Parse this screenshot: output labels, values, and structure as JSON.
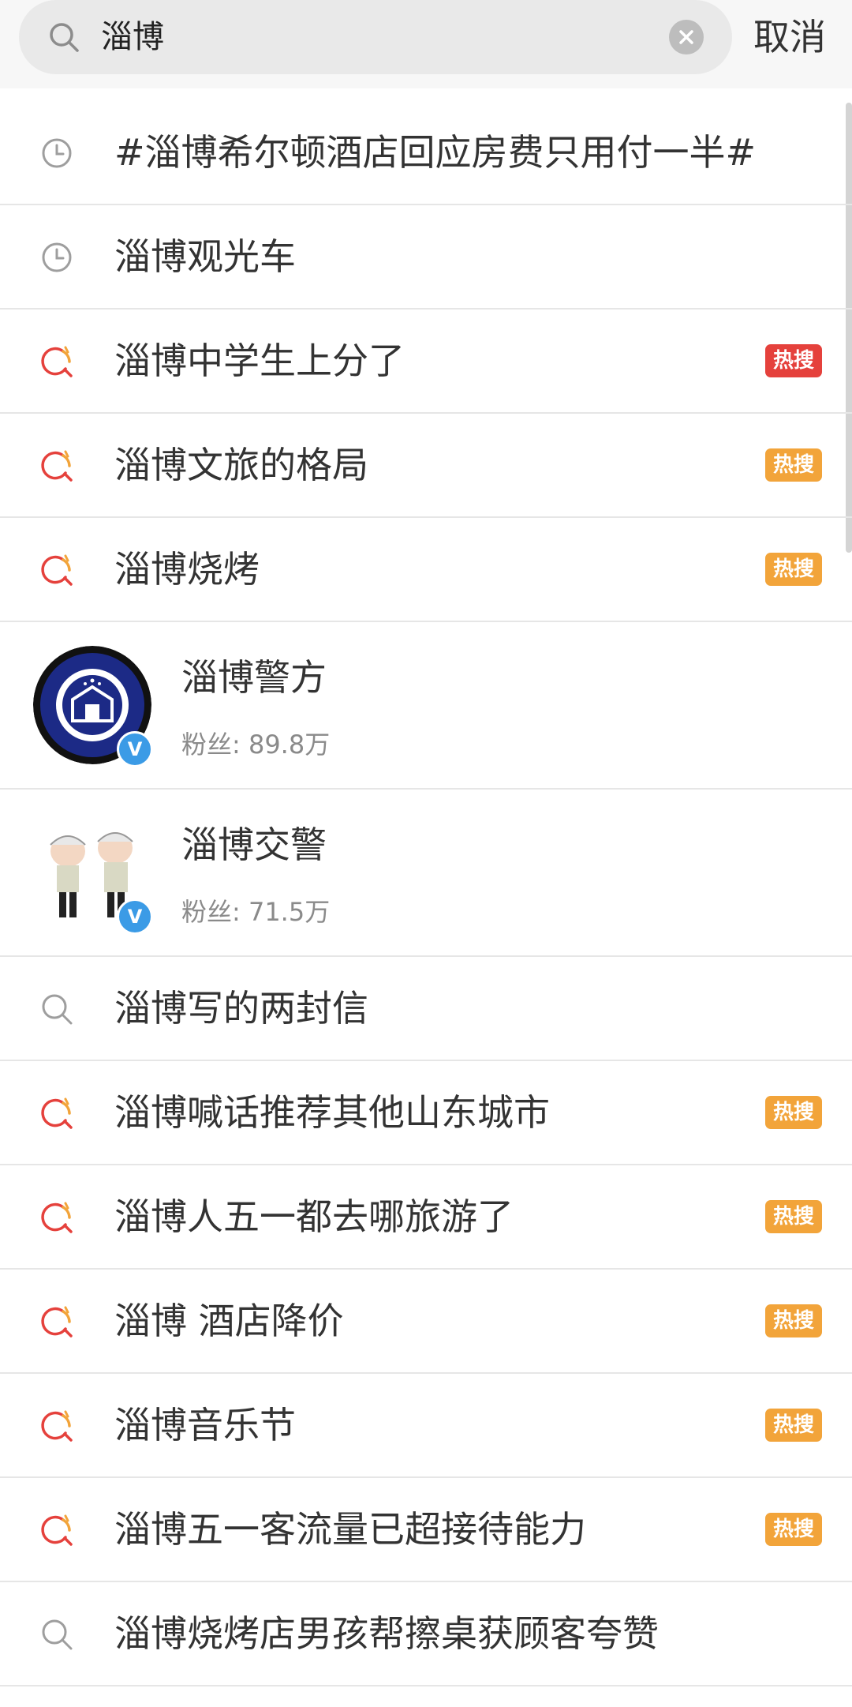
{
  "search": {
    "query": "淄博",
    "cancel_label": "取消"
  },
  "suggestions_top": [
    {
      "icon": "history-icon",
      "label": "#淄博希尔顿酒店回应房费只用付一半#",
      "badge": null
    },
    {
      "icon": "history-icon",
      "label": "淄博观光车",
      "badge": null
    },
    {
      "icon": "hot-search-icon",
      "label": "淄博中学生上分了",
      "badge": "热搜",
      "badge_color": "#e5413c"
    },
    {
      "icon": "hot-search-icon",
      "label": "淄博文旅的格局",
      "badge": "热搜",
      "badge_color": "#f2a43a"
    },
    {
      "icon": "hot-search-icon",
      "label": "淄博烧烤",
      "badge": "热搜",
      "badge_color": "#f2a43a"
    }
  ],
  "users": [
    {
      "name": "淄博警方",
      "fans": "粉丝: 89.8万",
      "verified": "V"
    },
    {
      "name": "淄博交警",
      "fans": "粉丝: 71.5万",
      "verified": "V"
    }
  ],
  "suggestions_bottom": [
    {
      "icon": "search-icon",
      "label": "淄博写的两封信",
      "badge": null
    },
    {
      "icon": "hot-search-icon",
      "label": "淄博喊话推荐其他山东城市",
      "badge": "热搜",
      "badge_color": "#f2a43a"
    },
    {
      "icon": "hot-search-icon",
      "label": "淄博人五一都去哪旅游了",
      "badge": "热搜",
      "badge_color": "#f2a43a"
    },
    {
      "icon": "hot-search-icon",
      "label": "淄博 酒店降价",
      "badge": "热搜",
      "badge_color": "#f2a43a"
    },
    {
      "icon": "hot-search-icon",
      "label": "淄博音乐节",
      "badge": "热搜",
      "badge_color": "#f2a43a"
    },
    {
      "icon": "hot-search-icon",
      "label": "淄博五一客流量已超接待能力",
      "badge": "热搜",
      "badge_color": "#f2a43a"
    },
    {
      "icon": "search-icon",
      "label": "淄博烧烤店男孩帮擦桌获顾客夸赞",
      "badge": null
    }
  ]
}
